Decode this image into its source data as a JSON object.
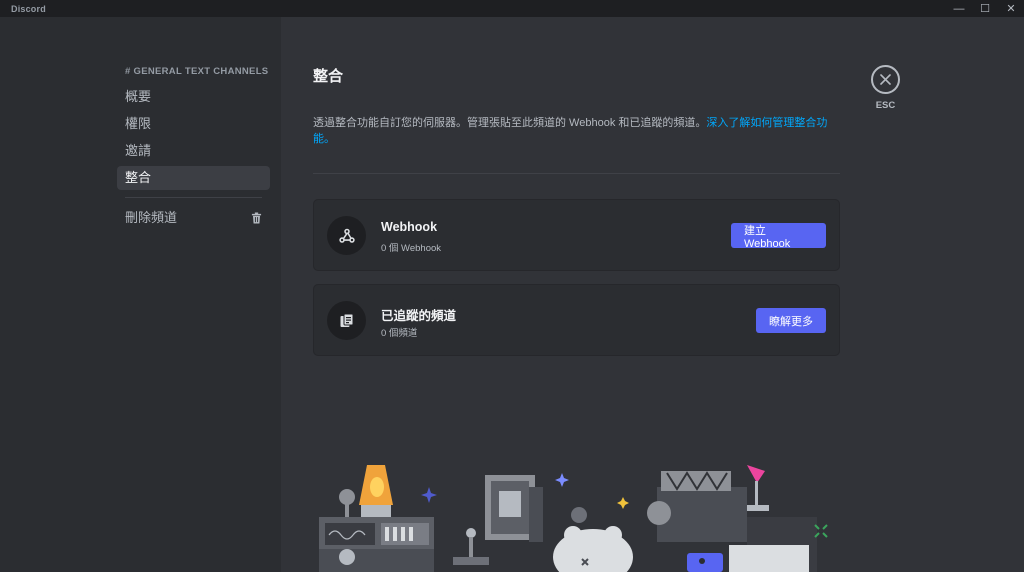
{
  "window": {
    "app_name": "Discord",
    "controls": {
      "minimize": "—",
      "maximize": "☐",
      "close": "✕"
    }
  },
  "sidebar": {
    "section_header": "# GENERAL TEXT CHANNELS",
    "items": [
      {
        "label": "概要"
      },
      {
        "label": "權限"
      },
      {
        "label": "邀請"
      },
      {
        "label": "整合",
        "active": true
      }
    ],
    "delete_label": "刪除頻道"
  },
  "main": {
    "title": "整合",
    "description": "透過整合功能自訂您的伺服器。管理張貼至此頻道的 Webhook 和已追蹤的頻道。",
    "learn_more_link": "深入了解如何管理整合功能。",
    "cards": [
      {
        "title": "Webhook",
        "subtitle": "0 個 Webhook",
        "button": "建立 Webhook",
        "icon": "webhook-icon"
      },
      {
        "title": "已追蹤的頻道",
        "subtitle": "0 個頻道",
        "button": "瞭解更多",
        "icon": "followed-channel-icon"
      }
    ]
  },
  "close": {
    "label": "ESC",
    "icon": "close-icon"
  },
  "colors": {
    "accent": "#5865f2",
    "link": "#00a8fc",
    "sidebar_bg": "#2b2d31",
    "main_bg": "#313338"
  }
}
